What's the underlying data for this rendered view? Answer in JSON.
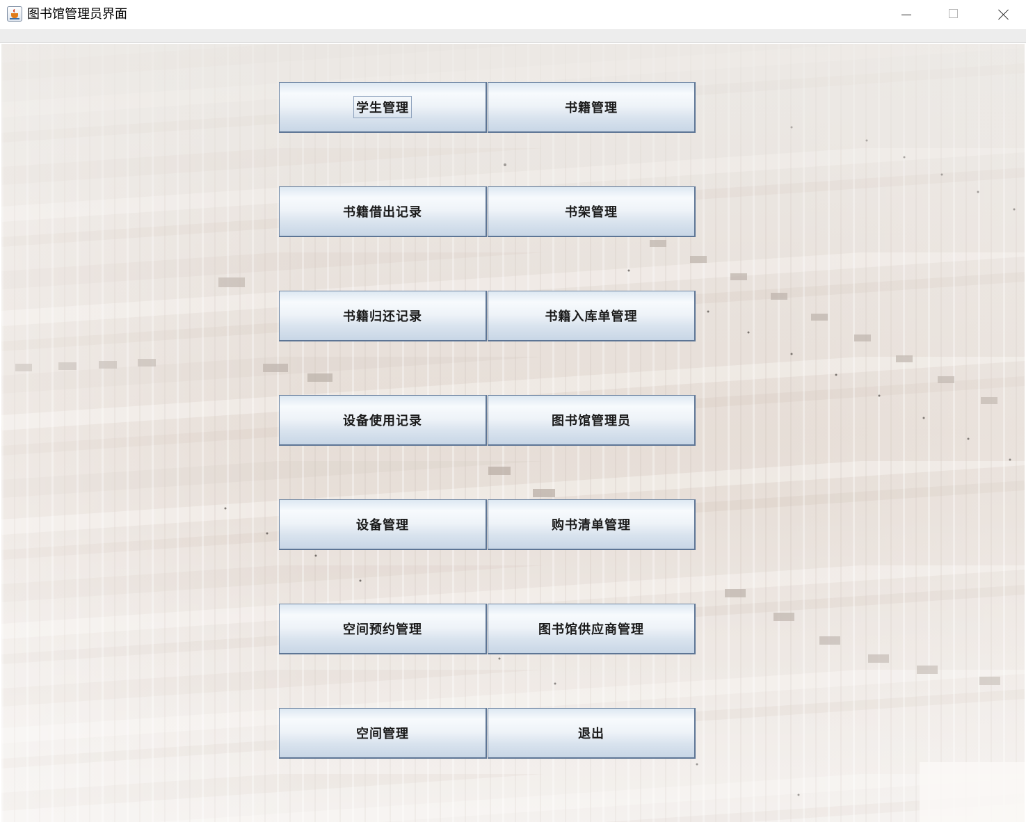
{
  "window": {
    "title": "图书馆管理员界面",
    "app_icon": "java-cup-icon"
  },
  "buttons": {
    "student_mgmt": "学生管理",
    "book_mgmt": "书籍管理",
    "borrow_records": "书籍借出记录",
    "shelf_mgmt": "书架管理",
    "return_records": "书籍归还记录",
    "stock_in_mgmt": "书籍入库单管理",
    "device_usage_records": "设备使用记录",
    "librarian": "图书馆管理员",
    "device_mgmt": "设备管理",
    "purchase_list_mgmt": "购书清单管理",
    "space_reservation_mgmt": "空间预约管理",
    "supplier_mgmt": "图书馆供应商管理",
    "space_mgmt": "空间管理",
    "exit": "退出"
  },
  "focused_button": "student_mgmt",
  "colors": {
    "button_border": "#6e85a2",
    "button_gradient_top": "#f7fafd",
    "button_gradient_bottom": "#c8d6e6",
    "menubar": "#ededed",
    "background_tint": "#e9e5e1"
  }
}
